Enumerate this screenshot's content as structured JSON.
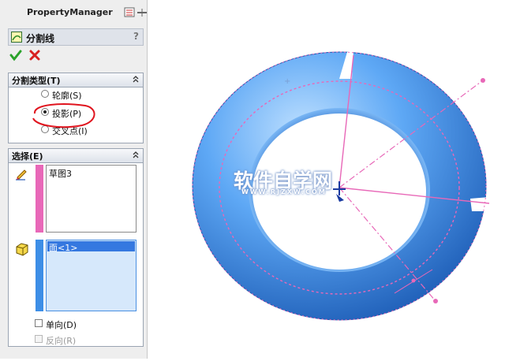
{
  "property_manager": {
    "title": "PropertyManager",
    "feature_name": "分割线",
    "help": "?"
  },
  "split_type_group": {
    "label": "分割类型(T)",
    "options": [
      {
        "label": "轮廓(S)",
        "selected": false
      },
      {
        "label": "投影(P)",
        "selected": true
      },
      {
        "label": "交叉点(I)",
        "selected": false
      }
    ]
  },
  "selection_group": {
    "label": "选择(E)",
    "sketch_list": [
      "草图3"
    ],
    "face_list": [
      "面<1>"
    ],
    "checkboxes": [
      {
        "label": "单向(D)",
        "checked": false,
        "enabled": true
      },
      {
        "label": "反向(R)",
        "checked": false,
        "enabled": false
      }
    ]
  },
  "colors": {
    "torus_blue": "#4f9bf0",
    "sketch_pink": "#e868b8",
    "face_blue": "#3d8ee6",
    "annotation_red": "#e0141e"
  },
  "watermark": {
    "title": "软件自学网",
    "url": "WWW.RJZXW.COM"
  }
}
